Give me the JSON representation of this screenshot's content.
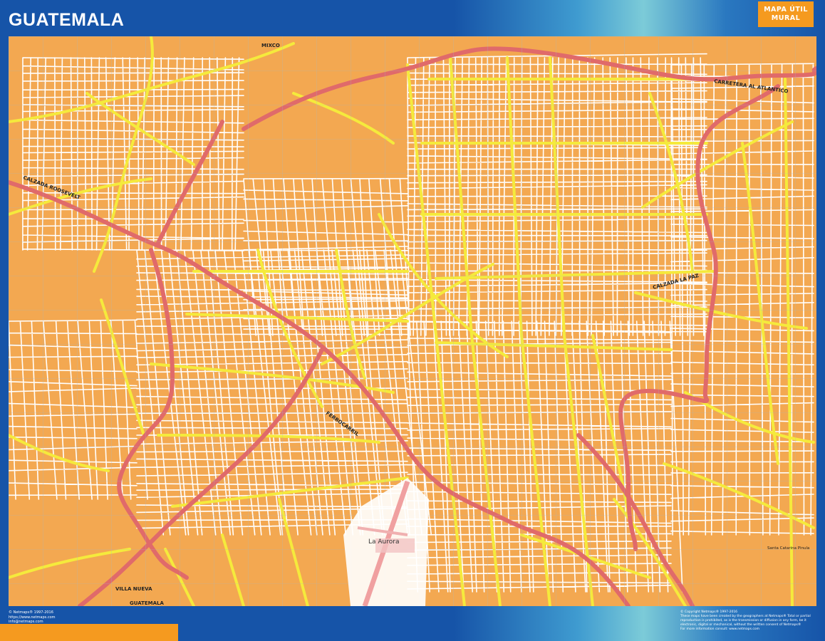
{
  "header": {
    "title": "GUATEMALA",
    "badge_line1": "MAPA ÚTIL",
    "badge_line2": "MURAL"
  },
  "map": {
    "labels": {
      "mixco": "MIXCO",
      "villa_nueva": "VILLA NUEVA",
      "guatemala": "GUATEMALA",
      "la_aurora": "La Aurora",
      "calzada_roosevelt": "CALZADA ROOSEVELT",
      "calzada_la_paz": "CALZADA LA PAZ",
      "carretera_atlantico": "CARRETERA AL ATLANTICO",
      "ferrocarril": "FERROCARRIL",
      "santa_catarina": "Santa Catarina Pinula"
    },
    "colors": {
      "land": "#f3a851",
      "major_road": "#e06a6a",
      "main_road": "#f5ea3c",
      "street": "#ffffff",
      "frame": "#1654a8",
      "accent": "#f59a1f"
    }
  },
  "footer": {
    "left_line1": "© Netmaps® 1997-2016",
    "left_line2": "https://www.netmaps.com",
    "left_line3": "info@netmaps.com",
    "right_line1": "© Copyright Netmaps® 1997-2016",
    "right_line2": "These maps have been created by the geographers at Netmaps® Total or partial",
    "right_line3": "reproduction is prohibited, as is the transmission or diffusion in any form, be it",
    "right_line4": "electronic, digital or mechanical, without the written consent of Netmaps®",
    "right_line5": "For more information consult: www.netmaps.com"
  }
}
